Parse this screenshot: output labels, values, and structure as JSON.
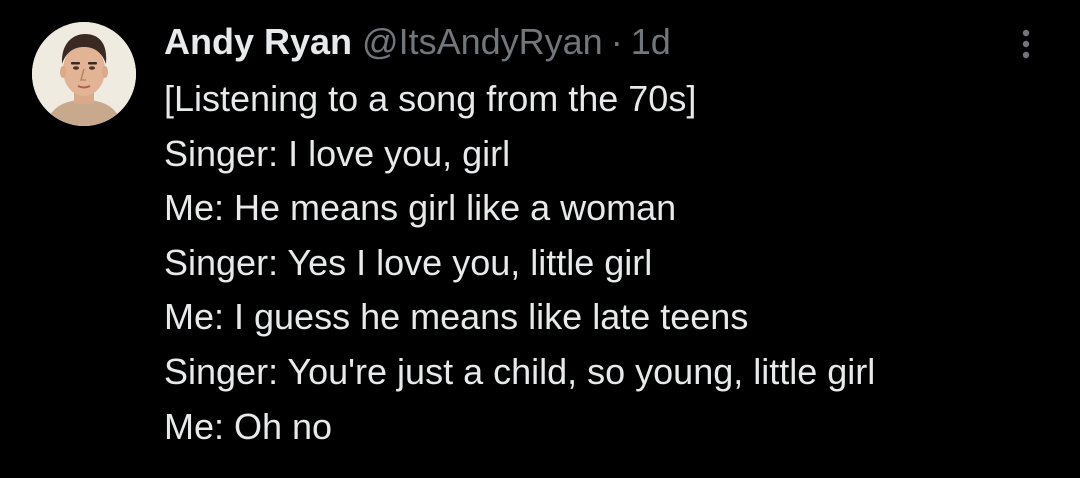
{
  "author": {
    "name": "Andy Ryan",
    "handle": "@ItsAndyRyan",
    "separator": "·",
    "timestamp": "1d"
  },
  "avatar_icon": "profile-photo",
  "more_icon": "vertical-ellipsis-icon",
  "colors": {
    "background": "#000000",
    "primary_text": "#e7e9ea",
    "secondary_text": "#71767b"
  },
  "tweet_lines": [
    "[Listening to a song from the 70s]",
    "Singer: I love you, girl",
    "Me: He means girl like a woman",
    "Singer: Yes I love you, little girl",
    "Me: I guess he means like late teens",
    "Singer: You're just a child, so young, little girl",
    "Me: Oh no"
  ]
}
